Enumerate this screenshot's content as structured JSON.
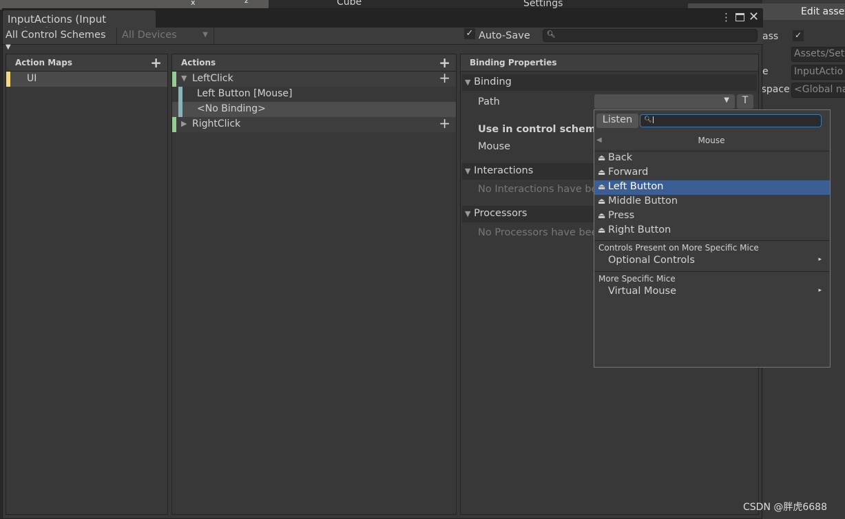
{
  "window": {
    "title": "InputActions (Input Actions)",
    "auto_save_label": "Auto-Save",
    "auto_save_checked": true,
    "search_placeholder": ""
  },
  "toolbar": {
    "control_schemes": "All Control Schemes",
    "devices": "All Devices"
  },
  "background": {
    "scene_object": "Cube",
    "settings": "Settings",
    "inspector_button": "Edit asset",
    "inspector_label1": "ass",
    "inspector_field1": "Assets/Set",
    "inspector_label2": "e",
    "inspector_field2": "InputActio",
    "inspector_label3": "espace",
    "inspector_field3": "<Global na",
    "gizmo_x": "x",
    "gizmo_z": "z"
  },
  "action_maps": {
    "header": "Action Maps",
    "items": [
      {
        "label": "UI",
        "color": "#f5d97f"
      }
    ]
  },
  "actions": {
    "header": "Actions",
    "items": [
      {
        "label": "LeftClick",
        "type": "action",
        "expanded": true
      },
      {
        "label": "Left Button [Mouse]",
        "type": "binding"
      },
      {
        "label": "<No Binding>",
        "type": "binding",
        "selected": true
      },
      {
        "label": "RightClick",
        "type": "action",
        "expanded": false
      }
    ]
  },
  "binding_properties": {
    "header": "Binding Properties",
    "binding_section": "Binding",
    "path_label": "Path",
    "path_value": "",
    "t_button": "T",
    "use_in_scheme": "Use in control scheme",
    "scheme_mouse": "Mouse",
    "interactions_section": "Interactions",
    "interactions_empty": "No Interactions have be",
    "processors_section": "Processors",
    "processors_empty": "No Processors have bee"
  },
  "popup": {
    "listen_label": "Listen",
    "search_value": "",
    "category": "Mouse",
    "items": [
      "Back",
      "Forward",
      "Left Button",
      "Middle Button",
      "Press",
      "Right Button"
    ],
    "selected_index": 2,
    "section1": "Controls Present on More Specific Mice",
    "section1_item": "Optional Controls",
    "section2": "More Specific Mice",
    "section2_item": "Virtual Mouse"
  },
  "watermark": "CSDN @胖虎6688"
}
